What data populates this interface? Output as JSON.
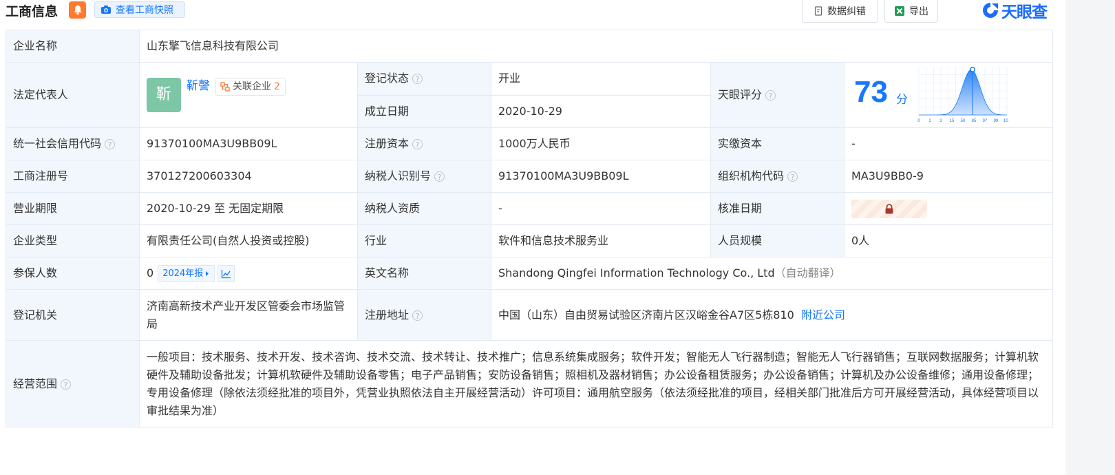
{
  "header": {
    "title": "工商信息",
    "snapshot_label": "查看工商快照",
    "data_correction_label": "数据纠错",
    "export_label": "导出",
    "logo_text": "天眼查"
  },
  "company": {
    "name_label": "企业名称",
    "name": "山东擎飞信息科技有限公司",
    "legal_rep_label": "法定代表人",
    "legal_rep_avatar": "靳",
    "legal_rep_name": "靳謦",
    "related_label": "关联企业",
    "related_count": "2",
    "reg_status_label": "登记状态",
    "reg_status": "开业",
    "est_date_label": "成立日期",
    "est_date": "2020-10-29",
    "score_label": "天眼评分",
    "score": "73",
    "score_unit": "分",
    "credit_code_label": "统一社会信用代码",
    "credit_code": "91370100MA3U9BB09L",
    "reg_capital_label": "注册资本",
    "reg_capital": "1000万人民币",
    "paid_capital_label": "实缴资本",
    "paid_capital": "-",
    "reg_no_label": "工商注册号",
    "reg_no": "370127200603304",
    "taxpayer_id_label": "纳税人识别号",
    "taxpayer_id": "91370100MA3U9BB09L",
    "org_code_label": "组织机构代码",
    "org_code": "MA3U9BB0-9",
    "term_label": "营业期限",
    "term": "2020-10-29 至 无固定期限",
    "taxpayer_qual_label": "纳税人资质",
    "taxpayer_qual": "-",
    "approve_date_label": "核准日期",
    "type_label": "企业类型",
    "type": "有限责任公司(自然人投资或控股)",
    "industry_label": "行业",
    "industry": "软件和信息技术服务业",
    "staff_size_label": "人员规模",
    "staff_size": "0人",
    "insured_label": "参保人数",
    "insured": "0",
    "report_label": "2024年报",
    "english_name_label": "英文名称",
    "english_name": "Shandong Qingfei Information Technology Co., Ltd",
    "auto_translate": "（自动翻译）",
    "authority_label": "登记机关",
    "authority": "济南高新技术产业开发区管委会市场监管局",
    "address_label": "注册地址",
    "address": "中国（山东）自由贸易试验区济南片区汉峪金谷A7区5栋810",
    "nearby_label": "附近公司",
    "scope_label": "经营范围",
    "scope": "一般项目：技术服务、技术开发、技术咨询、技术交流、技术转让、技术推广；信息系统集成服务；软件开发；智能无人飞行器制造；智能无人飞行器销售；互联网数据服务；计算机软硬件及辅助设备批发；计算机软硬件及辅助设备零售；电子产品销售；安防设备销售；照相机及器材销售；办公设备租赁服务；办公设备销售；计算机及办公设备维修；通用设备修理；专用设备修理（除依法须经批准的项目外，凭营业执照依法自主开展经营活动）许可项目：通用航空服务（依法须经批准的项目，经相关部门批准后方可开展经营活动，具体经营项目以审批结果为准）"
  },
  "score_chart": {
    "x_ticks": [
      "0",
      "1",
      "3",
      "15",
      "50",
      "85",
      "97",
      "99",
      "100"
    ]
  },
  "colors": {
    "accent": "#1677ff",
    "status_green": "#10a35a",
    "label_bg": "#f2f7fd",
    "bell_orange": "#ff7a2f"
  }
}
